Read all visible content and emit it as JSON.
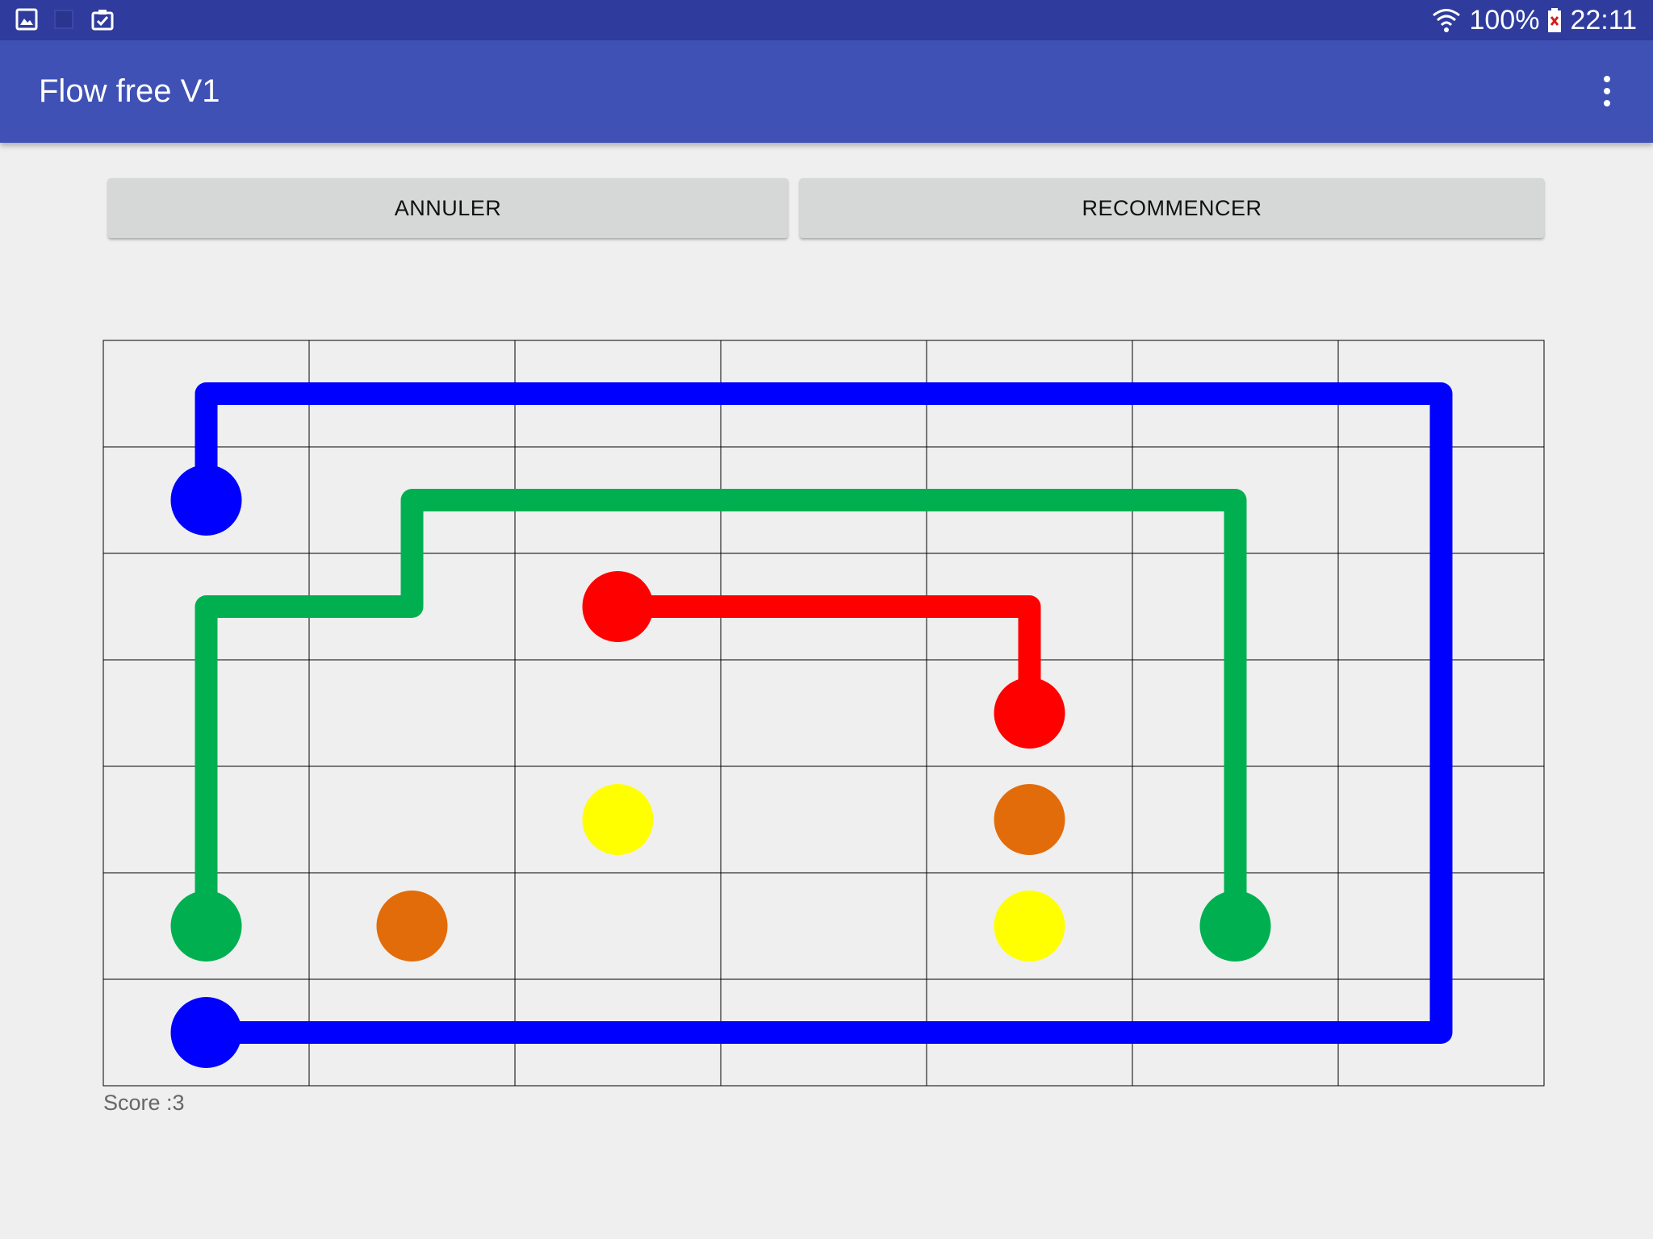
{
  "status_bar": {
    "battery": "100%",
    "time": "22:11",
    "icons": [
      "gallery-icon",
      "square-icon",
      "clipboard-check-icon",
      "wifi-icon",
      "battery-icon"
    ]
  },
  "app_bar": {
    "title": "Flow free V1",
    "menu_icon": "more-vert-icon"
  },
  "buttons": {
    "undo": "ANNULER",
    "restart": "RECOMMENCER"
  },
  "board": {
    "cols": 7,
    "rows": 7,
    "dots": [
      {
        "color": "blue",
        "row": 1,
        "col": 0
      },
      {
        "color": "blue",
        "row": 6,
        "col": 0
      },
      {
        "color": "green",
        "row": 5,
        "col": 0
      },
      {
        "color": "green",
        "row": 5,
        "col": 5
      },
      {
        "color": "red",
        "row": 2,
        "col": 2
      },
      {
        "color": "red",
        "row": 3,
        "col": 4
      },
      {
        "color": "yellow",
        "row": 4,
        "col": 2
      },
      {
        "color": "yellow",
        "row": 5,
        "col": 4
      },
      {
        "color": "orange",
        "row": 4,
        "col": 4
      },
      {
        "color": "orange",
        "row": 5,
        "col": 1
      }
    ],
    "paths": [
      {
        "color": "blue",
        "cells": [
          [
            1,
            0
          ],
          [
            0,
            0
          ],
          [
            0,
            1
          ],
          [
            0,
            2
          ],
          [
            0,
            3
          ],
          [
            0,
            4
          ],
          [
            0,
            5
          ],
          [
            0,
            6
          ],
          [
            1,
            6
          ],
          [
            2,
            6
          ],
          [
            3,
            6
          ],
          [
            4,
            6
          ],
          [
            5,
            6
          ],
          [
            6,
            6
          ],
          [
            6,
            5
          ],
          [
            6,
            4
          ],
          [
            6,
            3
          ],
          [
            6,
            2
          ],
          [
            6,
            1
          ],
          [
            6,
            0
          ]
        ]
      },
      {
        "color": "green",
        "cells": [
          [
            5,
            0
          ],
          [
            4,
            0
          ],
          [
            3,
            0
          ],
          [
            2,
            0
          ],
          [
            2,
            1
          ],
          [
            1,
            1
          ],
          [
            1,
            2
          ],
          [
            1,
            3
          ],
          [
            1,
            4
          ],
          [
            1,
            5
          ],
          [
            2,
            5
          ],
          [
            3,
            5
          ],
          [
            4,
            5
          ],
          [
            5,
            5
          ]
        ]
      },
      {
        "color": "red",
        "cells": [
          [
            2,
            2
          ],
          [
            2,
            3
          ],
          [
            2,
            4
          ],
          [
            3,
            4
          ]
        ]
      }
    ],
    "colors": {
      "blue": "#0000ff",
      "green": "#00b050",
      "red": "#ff0000",
      "yellow": "#ffff00",
      "orange": "#e36c0a"
    }
  },
  "score_text": "Score :3"
}
